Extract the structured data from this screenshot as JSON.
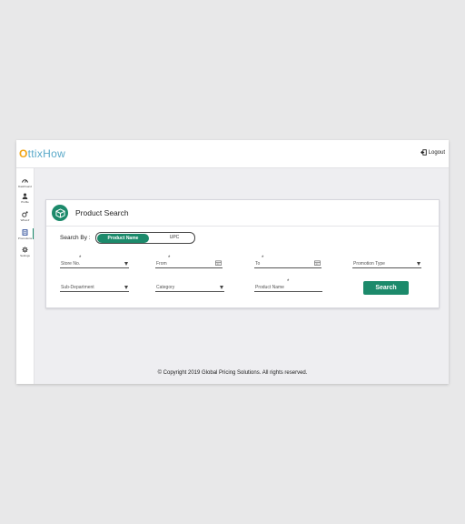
{
  "brand": {
    "logo_text": "OttixHow"
  },
  "header": {
    "logout_label": "Logout"
  },
  "sidebar": {
    "items": [
      {
        "label": "Dashboard",
        "icon": "dashboard-icon"
      },
      {
        "label": "Profile",
        "icon": "profile-icon"
      },
      {
        "label": "What-If",
        "icon": "whatif-icon"
      },
      {
        "label": "Promotions",
        "icon": "promotions-icon",
        "active": true
      },
      {
        "label": "Settings",
        "icon": "settings-icon"
      }
    ]
  },
  "card": {
    "title": "Product Search",
    "search_by_label": "Search By :",
    "toggle": {
      "active": "Product Name",
      "other": "UPC"
    },
    "fields": {
      "store_no": "Store No.",
      "from": "From",
      "to": "To",
      "promotion_type": "Promotion Type",
      "sub_department": "Sub-Department",
      "category": "Category",
      "product_name": "Product Name"
    },
    "required_mark": "*",
    "search_button": "Search"
  },
  "footer": {
    "copyright": "© Copyright 2019  Global Pricing Solutions. All rights reserved."
  },
  "colors": {
    "accent": "#1c8a6b",
    "logo_blue": "#5aa9c9",
    "logo_orange": "#f2a516"
  }
}
